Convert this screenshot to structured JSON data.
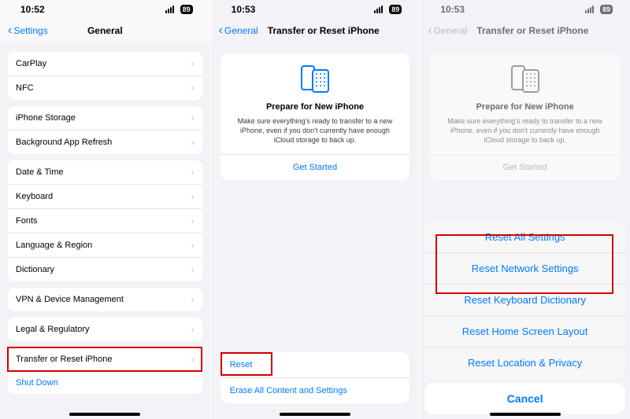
{
  "screen1": {
    "time": "10:52",
    "battery": "89",
    "back_label": "Settings",
    "title": "General",
    "group1": [
      "CarPlay",
      "NFC"
    ],
    "group2": [
      "iPhone Storage",
      "Background App Refresh"
    ],
    "group3": [
      "Date & Time",
      "Keyboard",
      "Fonts",
      "Language & Region",
      "Dictionary"
    ],
    "group4": [
      "VPN & Device Management"
    ],
    "group5": [
      "Legal & Regulatory"
    ],
    "group6": [
      "Transfer or Reset iPhone",
      "Shut Down"
    ]
  },
  "screen2": {
    "time": "10:53",
    "battery": "89",
    "back_label": "General",
    "title": "Transfer or Reset iPhone",
    "card_title": "Prepare for New iPhone",
    "card_desc": "Make sure everything's ready to transfer to a new iPhone, even if you don't currently have enough iCloud storage to back up.",
    "card_link": "Get Started",
    "reset": "Reset",
    "erase": "Erase All Content and Settings"
  },
  "screen3": {
    "time": "10:53",
    "battery": "89",
    "back_label": "General",
    "title": "Transfer or Reset iPhone",
    "card_title": "Prepare for New iPhone",
    "card_desc": "Make sure everything's ready to transfer to a new iPhone, even if you don't currently have enough iCloud storage to back up.",
    "card_link": "Get Started",
    "sheet": [
      "Reset All Settings",
      "Reset Network Settings",
      "Reset Keyboard Dictionary",
      "Reset Home Screen Layout",
      "Reset Location & Privacy"
    ],
    "cancel": "Cancel"
  }
}
